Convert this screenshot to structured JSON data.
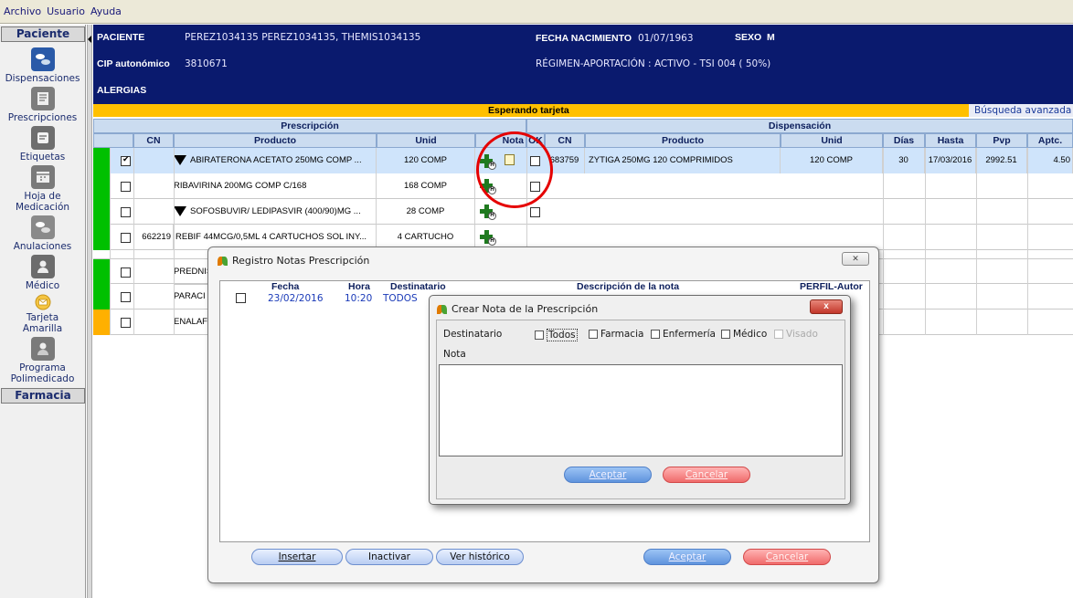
{
  "menu": {
    "items": [
      "Archivo",
      "Usuario",
      "Ayuda"
    ]
  },
  "sidebar": {
    "section1": "Paciente",
    "section2": "Farmacia",
    "items": [
      {
        "label": "Dispensaciones",
        "icon": "pills-icon"
      },
      {
        "label": "Prescripciones",
        "icon": "prescription-icon"
      },
      {
        "label": "Etiquetas",
        "icon": "label-icon"
      },
      {
        "label": "Hoja de Medicación",
        "icon": "calendar-icon"
      },
      {
        "label": "Anulaciones",
        "icon": "cancel-pills-icon"
      },
      {
        "label": "Médico",
        "icon": "doctor-icon"
      },
      {
        "label": "Tarjeta Amarilla",
        "icon": "envelope-icon"
      },
      {
        "label": "Programa Polimedicado",
        "icon": "person-icon"
      }
    ]
  },
  "patient": {
    "label_paciente": "PACIENTE",
    "name": "PEREZ1034135 PEREZ1034135, THEMIS1034135",
    "label_fecha": "FECHA NACIMIENTO",
    "fecha": "01/07/1963",
    "label_sexo": "SEXO",
    "sexo": "M",
    "label_cip": "CIP autonómico",
    "cip": "3810671",
    "regimen": "RÉGIMEN-APORTACIÓN : ACTIVO - TSI 004 ( 50%)",
    "label_alergias": "ALERGIAS"
  },
  "status": {
    "text": "Esperando tarjeta",
    "search": "Búsqueda avanzada"
  },
  "grid": {
    "group_prescripcion": "Prescripción",
    "group_dispensacion": "Dispensación",
    "headers": [
      "CN",
      "Producto",
      "Unid",
      "Nota",
      "OK",
      "CN",
      "Producto",
      "Unid",
      "Días",
      "Hasta",
      "Pvp",
      "Aptc."
    ],
    "rows": [
      {
        "cn": "",
        "producto": "ABIRATERONA ACETATO 250MG COMP ...",
        "unid": "120 COMP",
        "d_cn": "683759",
        "d_producto": "ZYTIGA 250MG 120 COMPRIMIDOS",
        "d_unid": "120 COMP",
        "dias": "30",
        "hasta": "17/03/2016",
        "pvp": "2992.51",
        "aptc": "4.50"
      },
      {
        "cn": "",
        "producto": "RIBAVIRINA 200MG COMP C/168",
        "unid": "168 COMP"
      },
      {
        "cn": "",
        "producto": "SOFOSBUVIR/ LEDIPASVIR (400/90)MG ...",
        "unid": "28 COMP"
      },
      {
        "cn": "662219",
        "producto": "REBIF 44MCG/0,5ML 4 CARTUCHOS SOL INY...",
        "unid": "4 CARTUCHO"
      },
      {
        "cn": "",
        "producto": "PREDNIS",
        "unid": ""
      },
      {
        "cn": "",
        "producto": "PARACI",
        "unid": ""
      },
      {
        "cn": "",
        "producto": "ENALAF",
        "unid": ""
      }
    ]
  },
  "dialog_registro": {
    "title": "Registro Notas Prescripción",
    "close": "✕",
    "headers": [
      "Fecha",
      "Hora",
      "Destinatario",
      "Descripción de la nota",
      "PERFIL-Autor"
    ],
    "row": {
      "fecha": "23/02/2016",
      "hora": "10:20",
      "destinatario": "TODOS"
    },
    "btn_insertar": "Insertar",
    "btn_inactivar": "Inactivar",
    "btn_historico": "Ver histórico",
    "btn_aceptar": "Aceptar",
    "btn_cancelar": "Cancelar"
  },
  "dialog_crear": {
    "title": "Crear Nota de la Prescripción",
    "close": "x",
    "label_destinatario": "Destinatario",
    "label_nota": "Nota",
    "options": [
      "Todos",
      "Farmacia",
      "Enfermería",
      "Médico",
      "Visado"
    ],
    "btn_aceptar": "Aceptar",
    "btn_cancelar": "Cancelar"
  },
  "colors": {
    "header_navy": "#0a1a6e",
    "status_amber": "#ffc000",
    "row_green": "#00c000",
    "row_yellow": "#ffb000",
    "annotation_red": "#e50000"
  }
}
